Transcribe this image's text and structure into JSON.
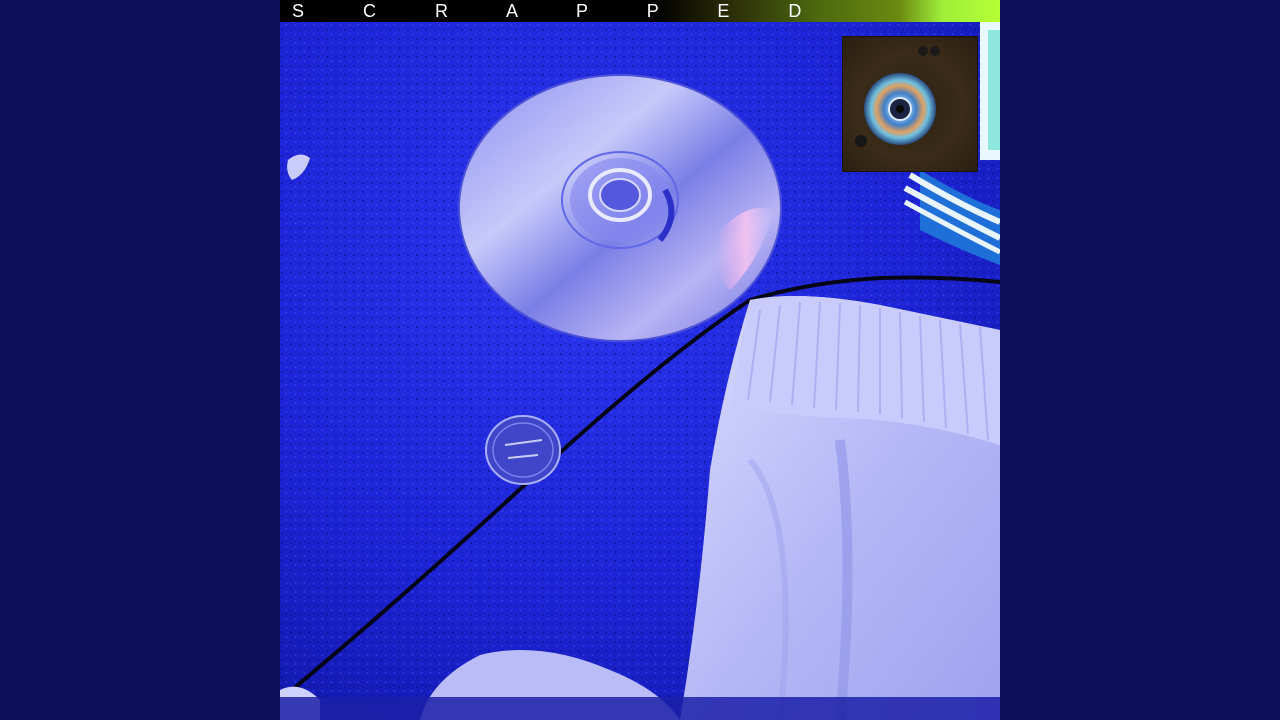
{
  "cover": {
    "title": "S C R A P P E D"
  },
  "colors": {
    "background": "#0c0f5a",
    "cover_base": "#1a21d8",
    "title_strip_accent": "#b6ff35"
  }
}
